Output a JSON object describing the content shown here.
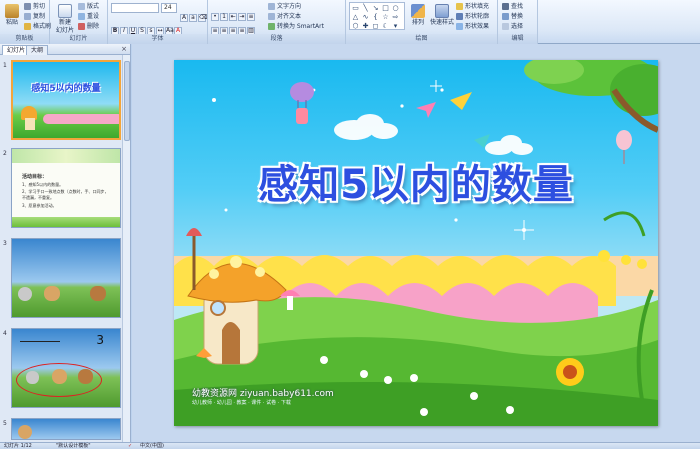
{
  "ribbon": {
    "clipboard": {
      "label": "剪贴板",
      "paste": "粘贴",
      "cut": "剪切",
      "copy": "复制",
      "format_painter": "格式刷"
    },
    "slides": {
      "label": "幻灯片",
      "new_slide": "新建\n幻灯片",
      "layout": "版式",
      "reset": "重设",
      "delete": "删除"
    },
    "font": {
      "label": "字体",
      "font_name": "",
      "font_size": "24"
    },
    "paragraph": {
      "label": "段落",
      "text_direction": "文字方向",
      "align_text": "对齐文本",
      "smartart": "转换为 SmartArt"
    },
    "drawing": {
      "label": "绘图",
      "arrange": "排列",
      "quick_styles": "快速样式",
      "shape_fill": "形状填充",
      "shape_outline": "形状轮廓",
      "shape_effects": "形状效果"
    },
    "editing": {
      "label": "编辑",
      "find": "查找",
      "replace": "替换",
      "select": "选择"
    }
  },
  "panel": {
    "tabs": [
      "幻灯片",
      "大纲"
    ],
    "close": "×",
    "thumbs": [
      {
        "num": "1",
        "title": "感知5以内的数量",
        "selected": true
      },
      {
        "num": "2",
        "title": "活动目标：",
        "lines": [
          "1、感知5以内的数量。",
          "2、学习手口一致地点数（点数时，手、口同步，不遗漏，不重复。",
          "3、愿意参加活动。"
        ]
      },
      {
        "num": "3"
      },
      {
        "num": "4",
        "digit": "3"
      },
      {
        "num": "5"
      }
    ]
  },
  "slide": {
    "title": "感知5以内的数量",
    "watermark": "幼教资源网 ziyuan.baby611.com",
    "watermark_sub": "幼儿教师 · 幼儿园 · 教案 · 课件 · 试卷 · 下载"
  },
  "status": {
    "slide_info": "幻灯片 1/12",
    "theme": "\"默认设计模板\"",
    "language": "中文(中国)"
  },
  "colors": {
    "title": "#2d4fe0",
    "sky": "#19b9f0",
    "grass": "#5cc23a",
    "selection": "#f3a53b"
  }
}
